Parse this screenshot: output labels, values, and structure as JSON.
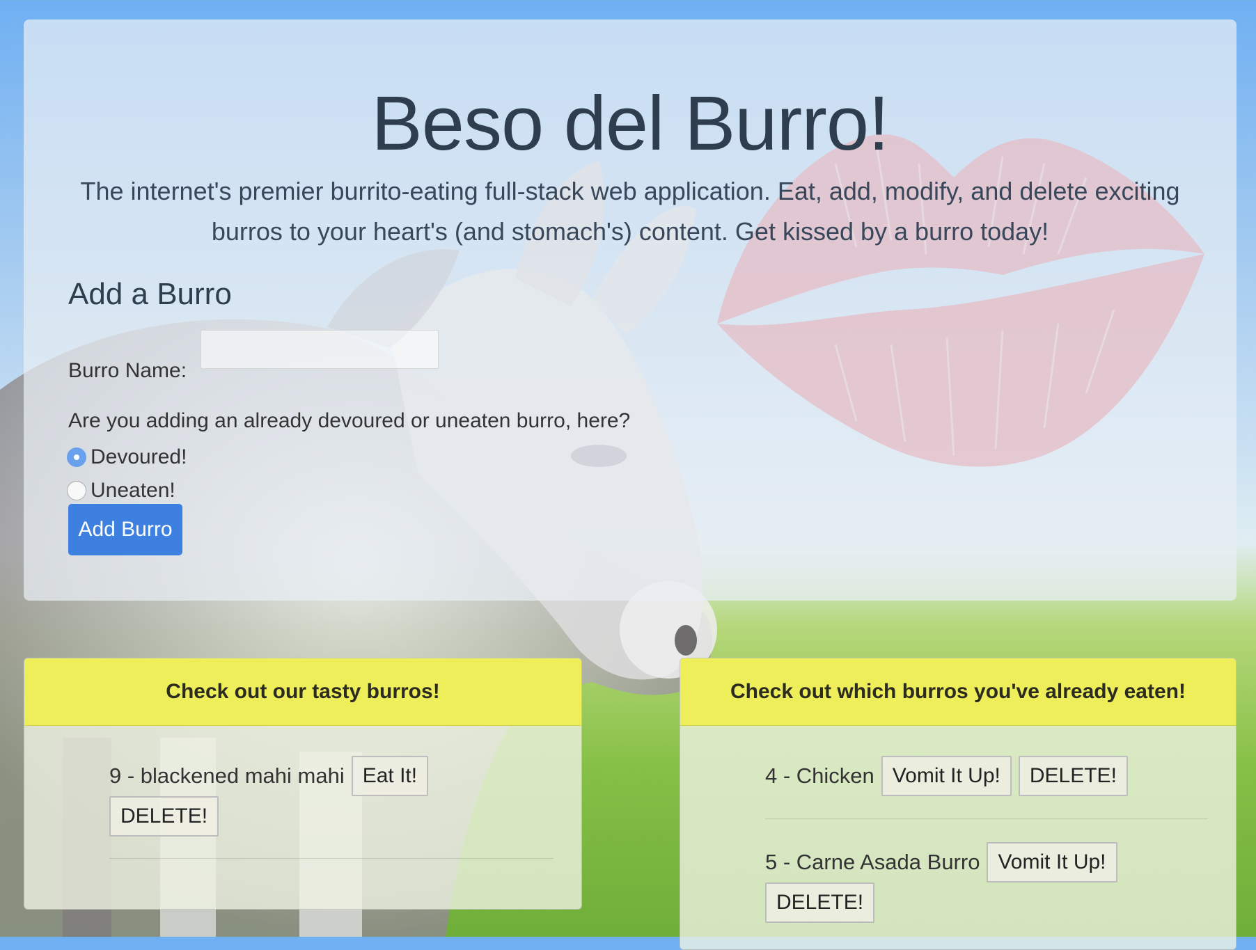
{
  "header": {
    "title": "Beso del Burro!",
    "lead": "The internet's premier burrito-eating full-stack web application. Eat, add, modify, and delete exciting burros to your heart's (and stomach's) content. Get kissed by a burro today!"
  },
  "add_form": {
    "heading": "Add a Burro",
    "name_label": "Burro Name:",
    "name_value": "",
    "question": "Are you adding an already devoured or uneaten burro, here?",
    "options": [
      {
        "label": "Devoured!",
        "checked": true
      },
      {
        "label": "Uneaten!",
        "checked": false
      }
    ],
    "submit_label": "Add Burro"
  },
  "uneaten": {
    "heading": "Check out our tasty burros!",
    "items": [
      {
        "text": "9 - blackened mahi mahi",
        "action_label": "Eat It!",
        "delete_label": "DELETE!"
      }
    ]
  },
  "eaten": {
    "heading": "Check out which burros you've already eaten!",
    "items": [
      {
        "text": "4 - Chicken",
        "action_label": "Vomit It Up!",
        "delete_label": "DELETE!"
      },
      {
        "text": "5 - Carne Asada Burro",
        "action_label": "Vomit It Up!",
        "delete_label": "DELETE!"
      }
    ]
  },
  "colors": {
    "primary_button": "#3d80e0",
    "card_header": "#eeed5a",
    "kiss": "#d8475a"
  },
  "icons": {
    "background": "donkey-photo",
    "overlay": "lipstick-kiss"
  }
}
